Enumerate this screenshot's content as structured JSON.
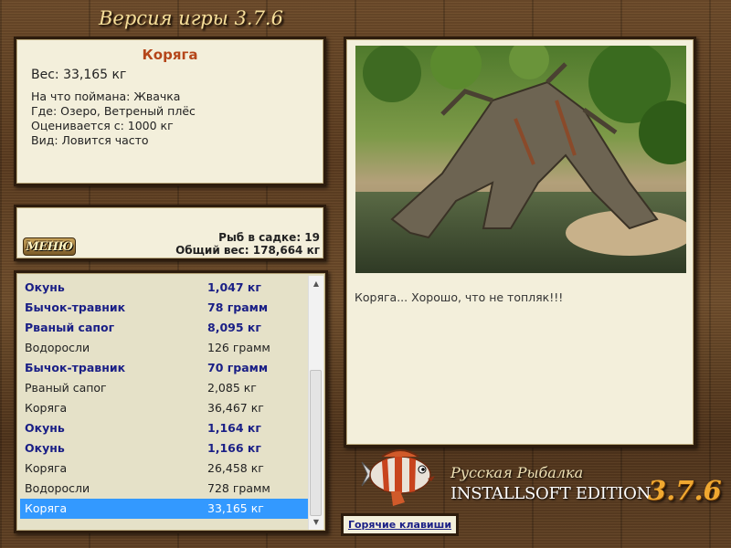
{
  "header": {
    "version_text": "Версия игры 3.7.6"
  },
  "info": {
    "title": "Коряга",
    "weight": "Вес: 33,165 кг",
    "caught_on": "На что поймана: Жвачка",
    "location": "Где: Озеро, Ветреный плёс",
    "value": "Оценивается с: 1000 кг",
    "frequency": "Вид: Ловится часто"
  },
  "stats": {
    "menu_label": "МЕНЮ",
    "fish_in_net": "Рыб в садке: 19",
    "total_weight": "Общий вес: 178,664 кг"
  },
  "catch_list": [
    {
      "name": "Окунь",
      "weight": "1,047 кг",
      "bold": true
    },
    {
      "name": "Бычок-травник",
      "weight": "78 грамм",
      "bold": true
    },
    {
      "name": "Рваный сапог",
      "weight": "8,095 кг",
      "bold": true
    },
    {
      "name": "Водоросли",
      "weight": "126 грамм",
      "bold": false
    },
    {
      "name": "Бычок-травник",
      "weight": "70 грамм",
      "bold": true
    },
    {
      "name": "Рваный сапог",
      "weight": "2,085 кг",
      "bold": false
    },
    {
      "name": "Коряга",
      "weight": "36,467 кг",
      "bold": false
    },
    {
      "name": "Окунь",
      "weight": "1,164 кг",
      "bold": true
    },
    {
      "name": "Окунь",
      "weight": "1,166 кг",
      "bold": true
    },
    {
      "name": "Коряга",
      "weight": "26,458 кг",
      "bold": false
    },
    {
      "name": "Водоросли",
      "weight": "728 грамм",
      "bold": false
    },
    {
      "name": "Коряга",
      "weight": "33,165 кг",
      "bold": false,
      "selected": true
    }
  ],
  "photo": {
    "caption": "Коряга... Хорошо, что не топляк!!!"
  },
  "logo": {
    "title": "Русская Рыбалка",
    "edition": "INSTALLSOFT EDITION",
    "version": "3.7.6"
  },
  "hotkeys_label": "Горячие клавиши",
  "colors": {
    "accent_title": "#b5461a",
    "bold_text": "#1a1f86",
    "selection": "#3399ff"
  }
}
